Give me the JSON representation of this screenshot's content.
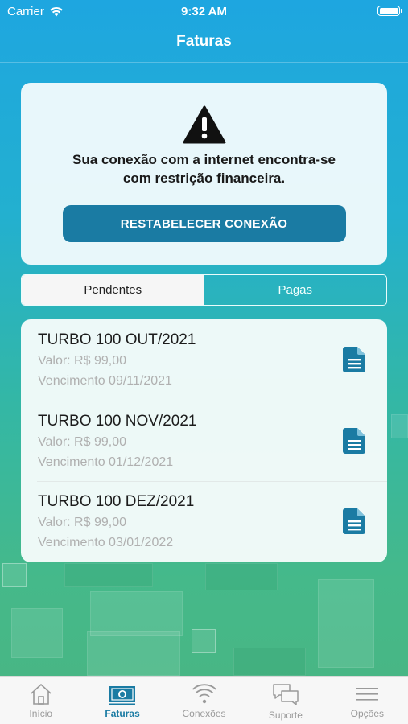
{
  "status_bar": {
    "carrier": "Carrier",
    "time": "9:32 AM"
  },
  "nav": {
    "title": "Faturas"
  },
  "alert": {
    "line1": "Sua conexão com a internet encontra-se",
    "line2": "com restrição financeira.",
    "button_label": "RESTABELECER CONEXÃO"
  },
  "segments": {
    "pending": "Pendentes",
    "paid": "Pagas",
    "selected": "Pendentes"
  },
  "invoices": [
    {
      "title": "TURBO 100 OUT/2021",
      "value": "Valor: R$ 99,00",
      "due": "Vencimento 09/11/2021"
    },
    {
      "title": "TURBO 100 NOV/2021",
      "value": "Valor: R$ 99,00",
      "due": "Vencimento 01/12/2021"
    },
    {
      "title": "TURBO 100 DEZ/2021",
      "value": "Valor: R$ 99,00",
      "due": "Vencimento 03/01/2022"
    }
  ],
  "tabs": [
    {
      "label": "Início",
      "icon": "home-icon"
    },
    {
      "label": "Faturas",
      "icon": "money-icon"
    },
    {
      "label": "Conexões",
      "icon": "wifi-icon"
    },
    {
      "label": "Suporte",
      "icon": "chat-icon"
    },
    {
      "label": "Opções",
      "icon": "menu-icon"
    }
  ],
  "colors": {
    "accent": "#1a7ba3",
    "inactive_tab": "#9a9a9a"
  }
}
